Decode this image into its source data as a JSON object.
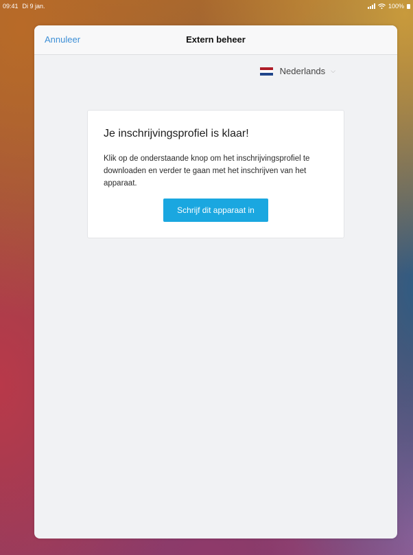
{
  "status_bar": {
    "time": "09:41",
    "date": "Di 9 jan.",
    "battery": "100%"
  },
  "nav": {
    "cancel_label": "Annuleer",
    "title": "Extern beheer"
  },
  "language": {
    "selected": "Nederlands",
    "flag_colors": [
      "#ae1c28",
      "#ffffff",
      "#21468b"
    ]
  },
  "card": {
    "title": "Je inschrijvingsprofiel is klaar!",
    "text": "Klik op de onderstaande knop om het inschrijvingsprofiel te downloaden en verder te gaan met het inschrijven van het apparaat.",
    "button_label": "Schrijf dit apparaat in"
  },
  "colors": {
    "accent": "#1aa7e0",
    "link": "#3d8fd6"
  }
}
